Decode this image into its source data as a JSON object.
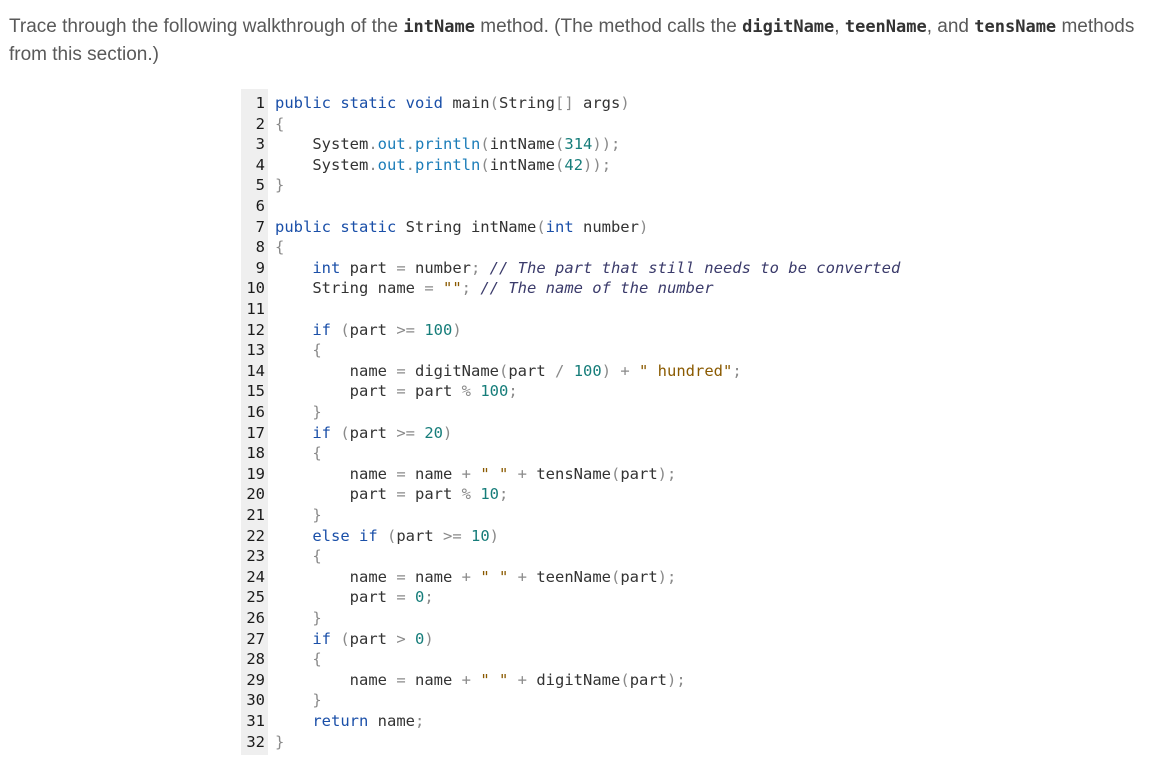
{
  "intro": {
    "t1": "Trace through the following walkthrough of the ",
    "c1": "intName",
    "t2": " method. (The method calls the ",
    "c2": "digitName",
    "t3": ", ",
    "c3": "teenName",
    "t4": ", and ",
    "c4": "tensName",
    "t5": " methods from this section.)"
  },
  "code": {
    "lines": [
      [
        [
          "kw",
          "public static void "
        ],
        [
          "pl",
          "main"
        ],
        [
          "op",
          "("
        ],
        [
          "pl",
          "String"
        ],
        [
          "op",
          "[] "
        ],
        [
          "pl",
          "args"
        ],
        [
          "op",
          ")"
        ]
      ],
      [
        [
          "op",
          "{"
        ]
      ],
      [
        [
          "pl",
          "    System"
        ],
        [
          "op",
          "."
        ],
        [
          "fn",
          "out"
        ],
        [
          "op",
          "."
        ],
        [
          "fn",
          "println"
        ],
        [
          "op",
          "("
        ],
        [
          "pl",
          "intName"
        ],
        [
          "op",
          "("
        ],
        [
          "num",
          "314"
        ],
        [
          "op",
          "));"
        ]
      ],
      [
        [
          "pl",
          "    System"
        ],
        [
          "op",
          "."
        ],
        [
          "fn",
          "out"
        ],
        [
          "op",
          "."
        ],
        [
          "fn",
          "println"
        ],
        [
          "op",
          "("
        ],
        [
          "pl",
          "intName"
        ],
        [
          "op",
          "("
        ],
        [
          "num",
          "42"
        ],
        [
          "op",
          "));"
        ]
      ],
      [
        [
          "op",
          "}"
        ]
      ],
      [],
      [
        [
          "kw",
          "public static "
        ],
        [
          "pl",
          "String intName"
        ],
        [
          "op",
          "("
        ],
        [
          "kw",
          "int "
        ],
        [
          "pl",
          "number"
        ],
        [
          "op",
          ")"
        ]
      ],
      [
        [
          "op",
          "{"
        ]
      ],
      [
        [
          "kw",
          "    int "
        ],
        [
          "pl",
          "part "
        ],
        [
          "op",
          "= "
        ],
        [
          "pl",
          "number"
        ],
        [
          "op",
          "; "
        ],
        [
          "cmt",
          "// The part that still needs to be converted"
        ]
      ],
      [
        [
          "pl",
          "    String name "
        ],
        [
          "op",
          "= "
        ],
        [
          "str",
          "\"\""
        ],
        [
          "op",
          "; "
        ],
        [
          "cmt",
          "// The name of the number"
        ]
      ],
      [],
      [
        [
          "kw",
          "    if "
        ],
        [
          "op",
          "("
        ],
        [
          "pl",
          "part "
        ],
        [
          "op",
          ">= "
        ],
        [
          "num",
          "100"
        ],
        [
          "op",
          ")"
        ]
      ],
      [
        [
          "op",
          "    {"
        ]
      ],
      [
        [
          "pl",
          "        name "
        ],
        [
          "op",
          "= "
        ],
        [
          "pl",
          "digitName"
        ],
        [
          "op",
          "("
        ],
        [
          "pl",
          "part "
        ],
        [
          "op",
          "/ "
        ],
        [
          "num",
          "100"
        ],
        [
          "op",
          ") + "
        ],
        [
          "str",
          "\" hundred\""
        ],
        [
          "op",
          ";"
        ]
      ],
      [
        [
          "pl",
          "        part "
        ],
        [
          "op",
          "= "
        ],
        [
          "pl",
          "part "
        ],
        [
          "op",
          "% "
        ],
        [
          "num",
          "100"
        ],
        [
          "op",
          ";"
        ]
      ],
      [
        [
          "op",
          "    }"
        ]
      ],
      [
        [
          "kw",
          "    if "
        ],
        [
          "op",
          "("
        ],
        [
          "pl",
          "part "
        ],
        [
          "op",
          ">= "
        ],
        [
          "num",
          "20"
        ],
        [
          "op",
          ")"
        ]
      ],
      [
        [
          "op",
          "    {"
        ]
      ],
      [
        [
          "pl",
          "        name "
        ],
        [
          "op",
          "= "
        ],
        [
          "pl",
          "name "
        ],
        [
          "op",
          "+ "
        ],
        [
          "str",
          "\" \""
        ],
        [
          "op",
          " + "
        ],
        [
          "pl",
          "tensName"
        ],
        [
          "op",
          "("
        ],
        [
          "pl",
          "part"
        ],
        [
          "op",
          ");"
        ]
      ],
      [
        [
          "pl",
          "        part "
        ],
        [
          "op",
          "= "
        ],
        [
          "pl",
          "part "
        ],
        [
          "op",
          "% "
        ],
        [
          "num",
          "10"
        ],
        [
          "op",
          ";"
        ]
      ],
      [
        [
          "op",
          "    }"
        ]
      ],
      [
        [
          "kw",
          "    else if "
        ],
        [
          "op",
          "("
        ],
        [
          "pl",
          "part "
        ],
        [
          "op",
          ">= "
        ],
        [
          "num",
          "10"
        ],
        [
          "op",
          ")"
        ]
      ],
      [
        [
          "op",
          "    {"
        ]
      ],
      [
        [
          "pl",
          "        name "
        ],
        [
          "op",
          "= "
        ],
        [
          "pl",
          "name "
        ],
        [
          "op",
          "+ "
        ],
        [
          "str",
          "\" \""
        ],
        [
          "op",
          " + "
        ],
        [
          "pl",
          "teenName"
        ],
        [
          "op",
          "("
        ],
        [
          "pl",
          "part"
        ],
        [
          "op",
          ");"
        ]
      ],
      [
        [
          "pl",
          "        part "
        ],
        [
          "op",
          "= "
        ],
        [
          "num",
          "0"
        ],
        [
          "op",
          ";"
        ]
      ],
      [
        [
          "op",
          "    }"
        ]
      ],
      [
        [
          "kw",
          "    if "
        ],
        [
          "op",
          "("
        ],
        [
          "pl",
          "part "
        ],
        [
          "op",
          "> "
        ],
        [
          "num",
          "0"
        ],
        [
          "op",
          ")"
        ]
      ],
      [
        [
          "op",
          "    {"
        ]
      ],
      [
        [
          "pl",
          "        name "
        ],
        [
          "op",
          "= "
        ],
        [
          "pl",
          "name "
        ],
        [
          "op",
          "+ "
        ],
        [
          "str",
          "\" \""
        ],
        [
          "op",
          " + "
        ],
        [
          "pl",
          "digitName"
        ],
        [
          "op",
          "("
        ],
        [
          "pl",
          "part"
        ],
        [
          "op",
          ");"
        ]
      ],
      [
        [
          "op",
          "    }"
        ]
      ],
      [
        [
          "kw",
          "    return "
        ],
        [
          "pl",
          "name"
        ],
        [
          "op",
          ";"
        ]
      ],
      [
        [
          "op",
          "}"
        ]
      ]
    ]
  }
}
